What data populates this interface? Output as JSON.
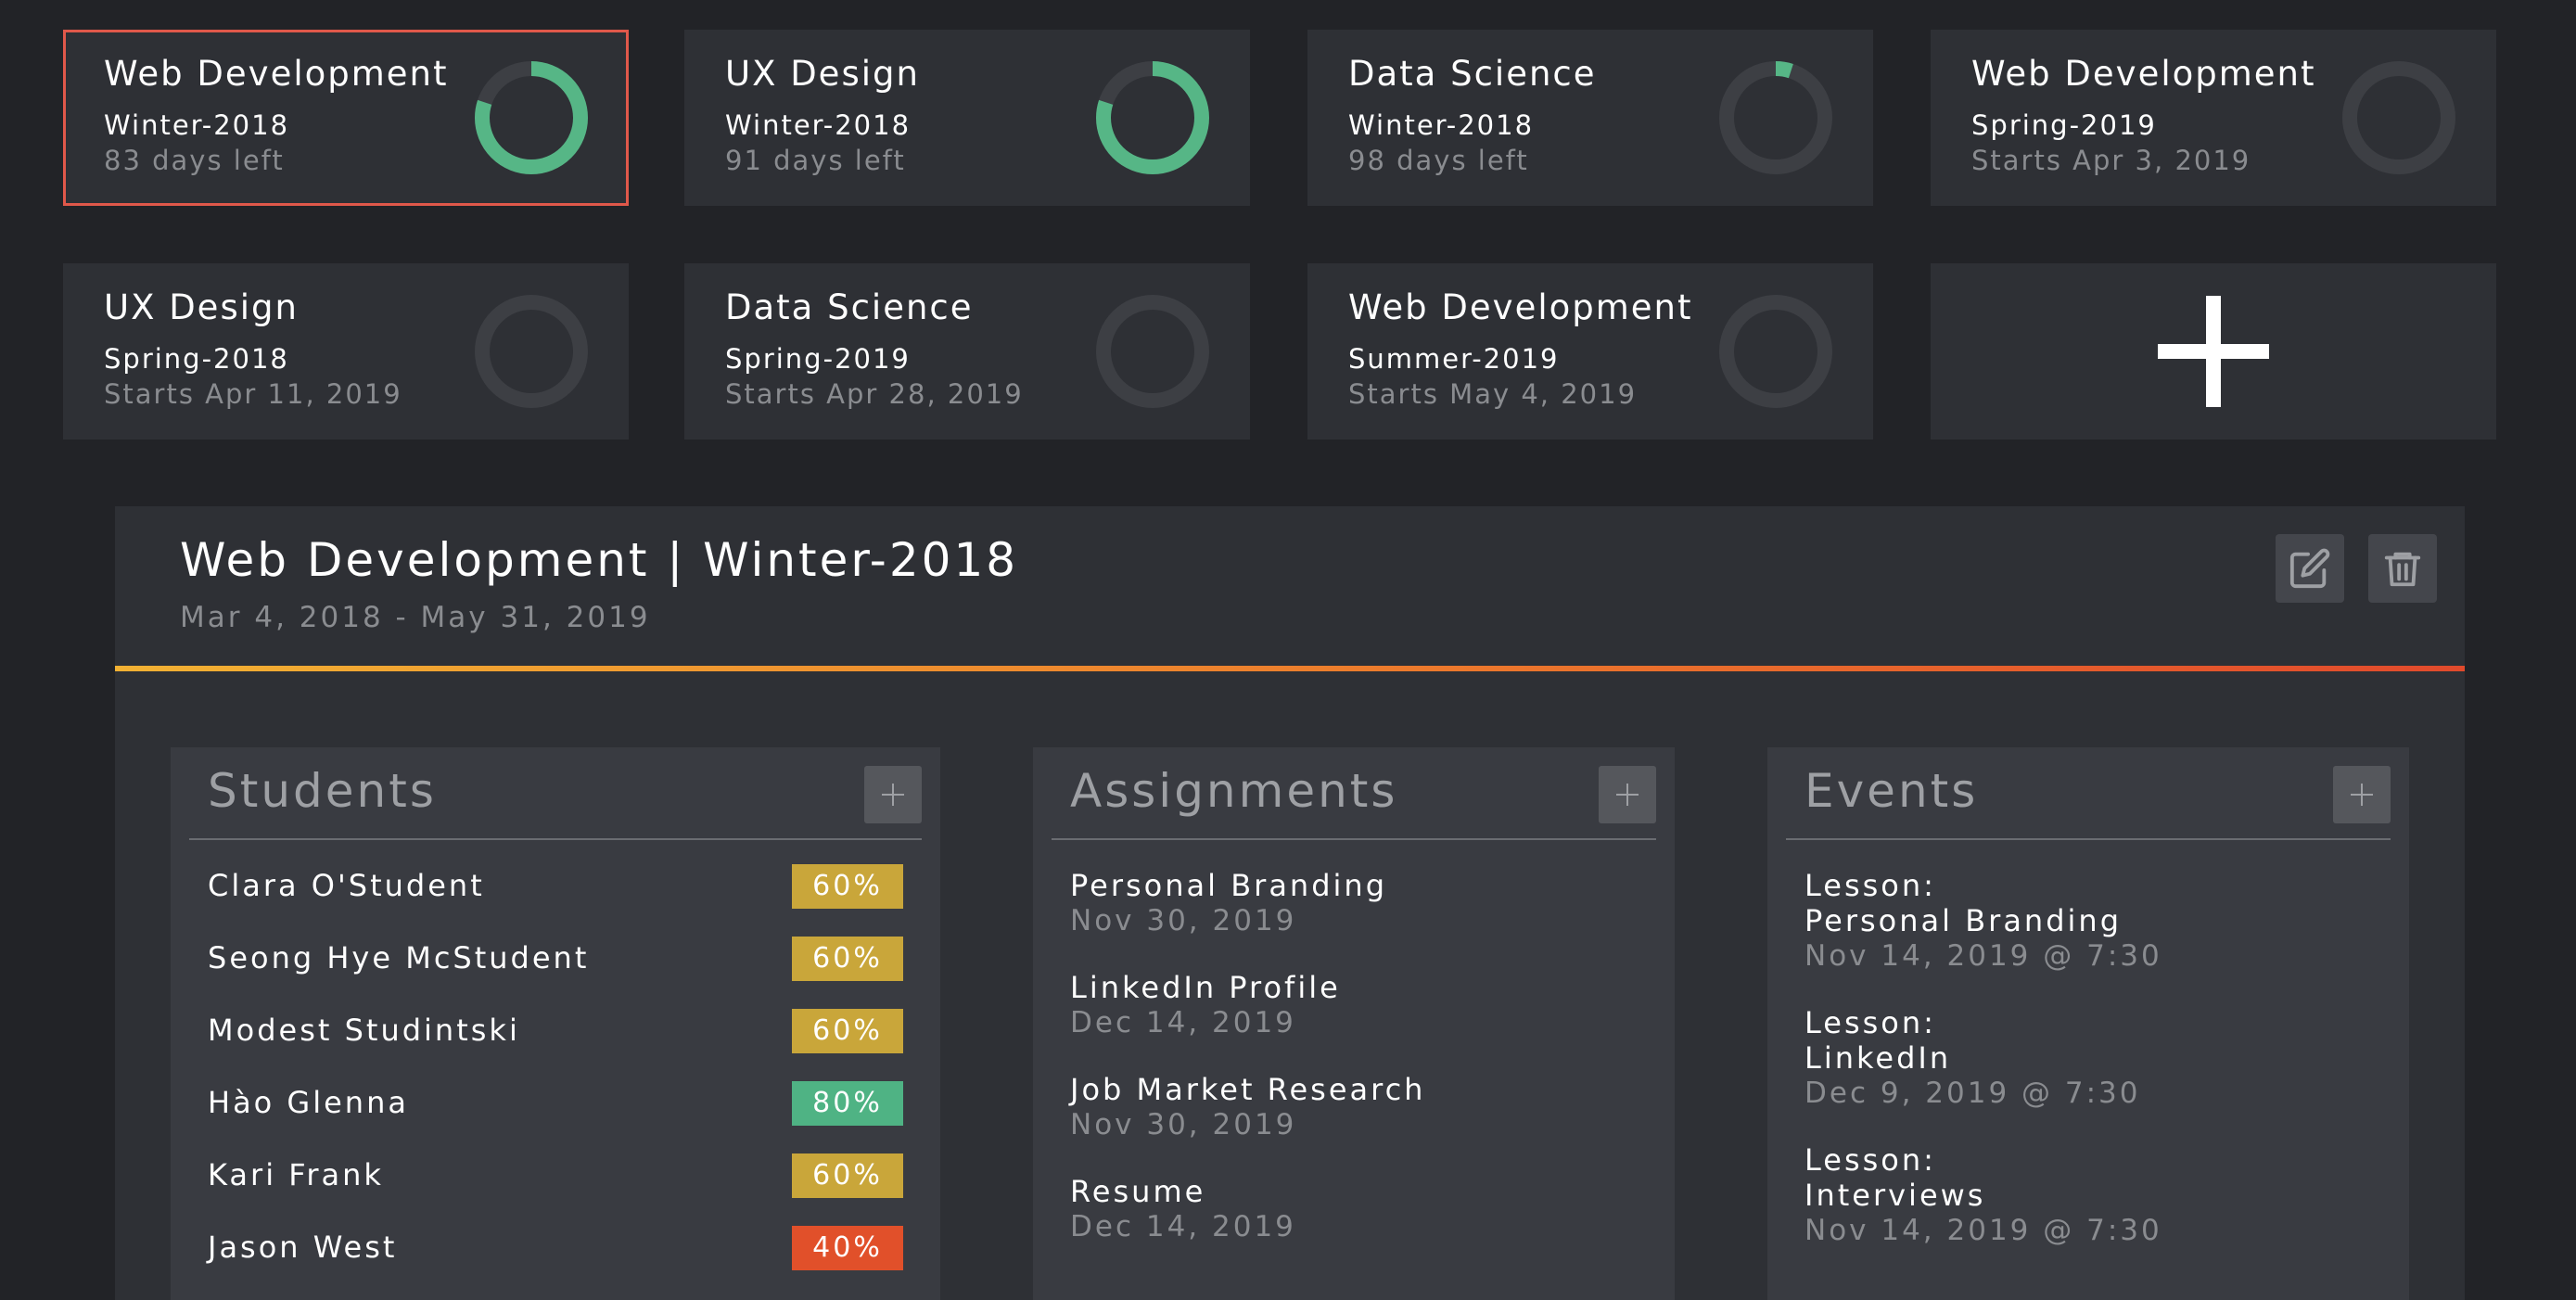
{
  "colors": {
    "progress_green": "#56b686",
    "ring_track": "#3d3f44",
    "badge_yellow": "#c9a63a",
    "badge_green": "#4fb384",
    "badge_red": "#e1502a",
    "selected_border": "#e0584a"
  },
  "courses": [
    {
      "title": "Web Development",
      "term": "Winter-2018",
      "sub": "83 days left",
      "progress": 0.8,
      "selected": true
    },
    {
      "title": "UX Design",
      "term": "Winter-2018",
      "sub": "91 days left",
      "progress": 0.8,
      "selected": false
    },
    {
      "title": "Data Science",
      "term": "Winter-2018",
      "sub": "98 days left",
      "progress": 0.05,
      "selected": false
    },
    {
      "title": "Web Development",
      "term": "Spring-2019",
      "sub": "Starts Apr 3, 2019",
      "progress": 0,
      "selected": false
    },
    {
      "title": "UX Design",
      "term": "Spring-2018",
      "sub": "Starts Apr 11, 2019",
      "progress": 0,
      "selected": false
    },
    {
      "title": "Data Science",
      "term": "Spring-2019",
      "sub": "Starts Apr 28, 2019",
      "progress": 0,
      "selected": false
    },
    {
      "title": "Web Development",
      "term": "Summer-2019",
      "sub": "Starts May 4, 2019",
      "progress": 0,
      "selected": false
    }
  ],
  "add_course_icon": "plus-icon",
  "detail": {
    "title": "Web Development | Winter-2018",
    "range": "Mar 4, 2018 - May 31, 2019",
    "edit_icon": "edit-icon",
    "delete_icon": "trash-icon"
  },
  "students": {
    "title": "Students",
    "items": [
      {
        "name": "Clara O'Student",
        "score": "60%",
        "status": "yellow"
      },
      {
        "name": "Seong Hye McStudent",
        "score": "60%",
        "status": "yellow"
      },
      {
        "name": "Modest Studintski",
        "score": "60%",
        "status": "yellow"
      },
      {
        "name": "Hào Glenna",
        "score": "80%",
        "status": "green"
      },
      {
        "name": "Kari Frank",
        "score": "60%",
        "status": "yellow"
      },
      {
        "name": "Jason West",
        "score": "40%",
        "status": "red"
      }
    ]
  },
  "assignments": {
    "title": "Assignments",
    "items": [
      {
        "name": "Personal Branding",
        "date": "Nov 30, 2019"
      },
      {
        "name": "LinkedIn Profile",
        "date": "Dec 14, 2019"
      },
      {
        "name": "Job Market Research",
        "date": "Nov 30, 2019"
      },
      {
        "name": "Resume",
        "date": "Dec 14, 2019"
      }
    ]
  },
  "events": {
    "title": "Events",
    "items": [
      {
        "kind": "Lesson:",
        "topic": "Personal Branding",
        "date": "Nov 14, 2019 @ 7:30"
      },
      {
        "kind": "Lesson:",
        "topic": "LinkedIn",
        "date": "Dec 9, 2019 @ 7:30"
      },
      {
        "kind": "Lesson:",
        "topic": "Interviews",
        "date": "Nov 14, 2019 @ 7:30"
      }
    ]
  }
}
